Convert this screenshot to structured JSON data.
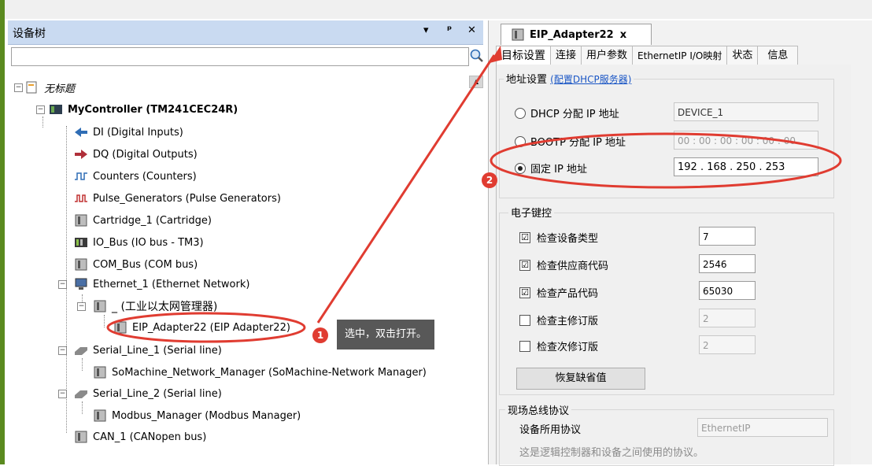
{
  "left_panel": {
    "title": "设备树",
    "controls": [
      "▾",
      "ᵖ",
      "✕"
    ],
    "tree": [
      {
        "label": "无标题"
      },
      {
        "label": "MyController (TM241CEC24R)"
      },
      {
        "label": "DI (Digital Inputs)"
      },
      {
        "label": "DQ (Digital Outputs)"
      },
      {
        "label": "Counters (Counters)"
      },
      {
        "label": "Pulse_Generators (Pulse Generators)"
      },
      {
        "label": "Cartridge_1 (Cartridge)"
      },
      {
        "label": "IO_Bus (IO bus - TM3)"
      },
      {
        "label": "COM_Bus (COM bus)"
      },
      {
        "label": "Ethernet_1 (Ethernet Network)"
      },
      {
        "label": "_ (工业以太网管理器)"
      },
      {
        "label": "EIP_Adapter22 (EIP Adapter22)"
      },
      {
        "label": "Serial_Line_1 (Serial line)"
      },
      {
        "label": "SoMachine_Network_Manager (SoMachine-Network Manager)"
      },
      {
        "label": "Serial_Line_2 (Serial line)"
      },
      {
        "label": "Modbus_Manager (Modbus Manager)"
      },
      {
        "label": "CAN_1 (CANopen bus)"
      }
    ]
  },
  "right_panel": {
    "doc_tab": {
      "label": "EIP_Adapter22",
      "close": "x"
    },
    "subtabs": [
      "目标设置",
      "连接",
      "用户参数",
      "EthernetIP I/O映射",
      "状态",
      "信息"
    ],
    "address": {
      "label": "地址设置",
      "link": "(配置DHCP服务器)",
      "dhcp_label": "DHCP 分配 IP 地址",
      "dhcp_value": "DEVICE_1",
      "bootp_label": "BOOTP 分配 IP 地址",
      "bootp_value": "00 : 00 : 00 : 00 : 00 : 00",
      "fixed_label": "固定 IP 地址",
      "fixed_value": "192  .  168  .  250  .  253"
    },
    "ekey": {
      "label": "电子键控",
      "rows": [
        {
          "label": "检查设备类型",
          "checked": "☑",
          "value": "7"
        },
        {
          "label": "检查供应商代码",
          "checked": "☑",
          "value": "2546"
        },
        {
          "label": "检查产品代码",
          "checked": "☑",
          "value": "65030"
        },
        {
          "label": "检查主修订版",
          "checked": "",
          "value": "2"
        },
        {
          "label": "检查次修订版",
          "checked": "",
          "value": "2"
        }
      ],
      "restore_button": "恢复缺省值"
    },
    "fieldbus": {
      "label": "现场总线协议",
      "proto_label": "设备所用协议",
      "proto_value": "EthernetIP",
      "desc": "这是逻辑控制器和设备之间使用的协议。"
    }
  },
  "annotations": {
    "badge1": "1",
    "badge2": "2",
    "tooltip": "选中，双击打开。"
  },
  "colors": {
    "accent_red": "#e03c31",
    "title_blue": "#c9daf1",
    "tooltip_bg": "#585858"
  }
}
